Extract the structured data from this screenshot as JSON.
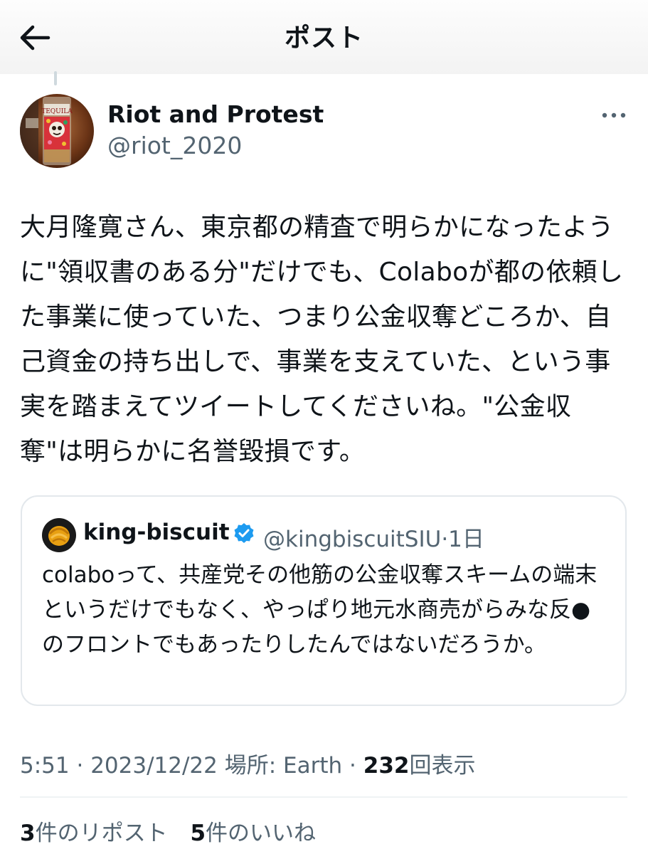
{
  "header": {
    "title": "ポスト",
    "back_icon": "arrow-left-icon"
  },
  "post": {
    "author": {
      "display_name": "Riot and Protest",
      "handle": "@riot_2020",
      "avatar_label": "TEQUILA"
    },
    "more_icon": "ellipsis-icon",
    "text": "大月隆寛さん、東京都の精査で明らかになったように\"領収書のある分\"だけでも、Colaboが都の依頼した事業に使っていた、つまり公金収奪どころか、自己資金の持ち出しで、事業を支えていた、という事実を踏まえてツイートしてくださいね。\"公金収奪\"は明らかに名誉毀損です。",
    "meta": {
      "time": "5:51",
      "separator": "·",
      "date": "2023/12/22",
      "location_label": "場所: Earth",
      "views_count": "232",
      "views_label": "回表示"
    },
    "stats": {
      "reposts_count": "3",
      "reposts_label": "件のリポスト",
      "likes_count": "5",
      "likes_label": "件のいいね"
    }
  },
  "quote": {
    "display_name": "king-biscuit",
    "verified_icon": "verified-badge-icon",
    "handle": "@kingbiscuitSIU",
    "separator": "·",
    "age": "1日",
    "text": "colaboって、共産党その他筋の公金収奪スキームの端末というだけでもなく、やっぱり地元水商売がらみな反●のフロントでもあったりしたんではないだろうか。"
  },
  "colors": {
    "text_primary": "#0f1419",
    "text_secondary": "#536471",
    "border": "#e3e8ec",
    "verified_blue": "#1d9bf0"
  }
}
